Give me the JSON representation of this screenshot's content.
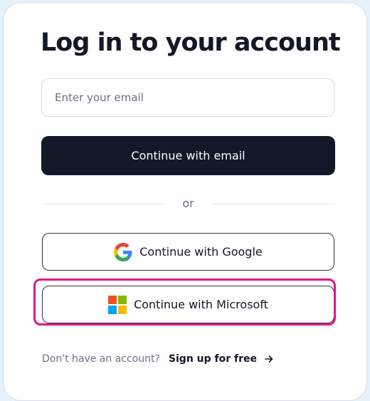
{
  "login": {
    "title": "Log in to your account",
    "email_placeholder": "Enter your email",
    "email_value": "",
    "continue_email_label": "Continue with email",
    "divider_text": "or",
    "google_label": "Continue with Google",
    "microsoft_label": "Continue with Microsoft",
    "footer_text": "Don't have an account?",
    "signup_label": "Sign up for free"
  },
  "icons": {
    "google": "google-logo-icon",
    "microsoft": "microsoft-logo-icon",
    "arrow": "arrow-right-icon"
  },
  "colors": {
    "background": "#e6f2fa",
    "primary": "#111827",
    "highlight": "#e1158a"
  }
}
